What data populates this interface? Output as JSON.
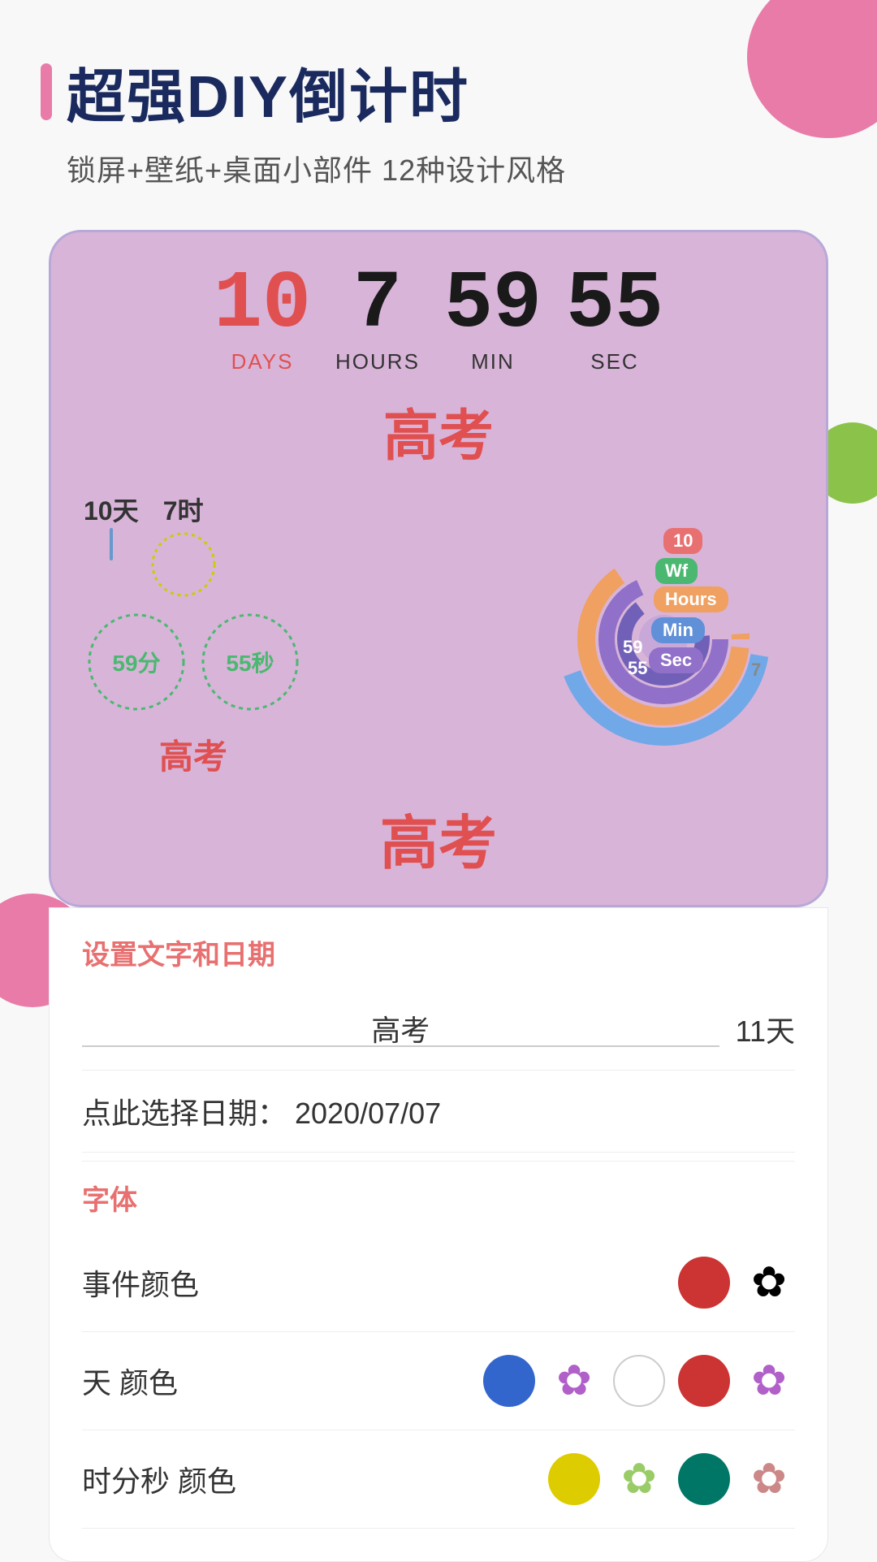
{
  "header": {
    "title": "超强DIY倒计时",
    "subtitle": "锁屏+壁纸+桌面小部件  12种设计风格",
    "accent_color": "#e87ba8"
  },
  "timer": {
    "days_value": "10",
    "days_label": "DAYS",
    "hours_value": "7",
    "hours_label": "HOURS",
    "min_value": "59",
    "min_label": "MIN",
    "sec_value": "55",
    "sec_label": "SEC"
  },
  "event": {
    "name": "高考",
    "name_bottom": "高考"
  },
  "gauges": {
    "days": "10天",
    "hours": "7时",
    "mins_label": "59分",
    "secs_label": "55秒"
  },
  "donut_labels": {
    "days": "10",
    "weeks": "Wf",
    "hours": "Hours",
    "min": "Min",
    "sec": "Sec",
    "seven": "7"
  },
  "settings": {
    "section_title": "设置文字和日期",
    "event_name": "高考",
    "days_remaining": "11天",
    "date_label": "点此选择日期：",
    "date_value": "2020/07/07"
  },
  "font_section": {
    "title": "字体",
    "event_color_label": "事件颜色",
    "day_color_label": "天 颜色",
    "hms_color_label": "时分秒 颜色",
    "event_color": "#cc3333",
    "day_colors": [
      "#3366cc",
      "#cc3333"
    ],
    "hms_colors": [
      "#ddcc00",
      "#007766"
    ]
  }
}
